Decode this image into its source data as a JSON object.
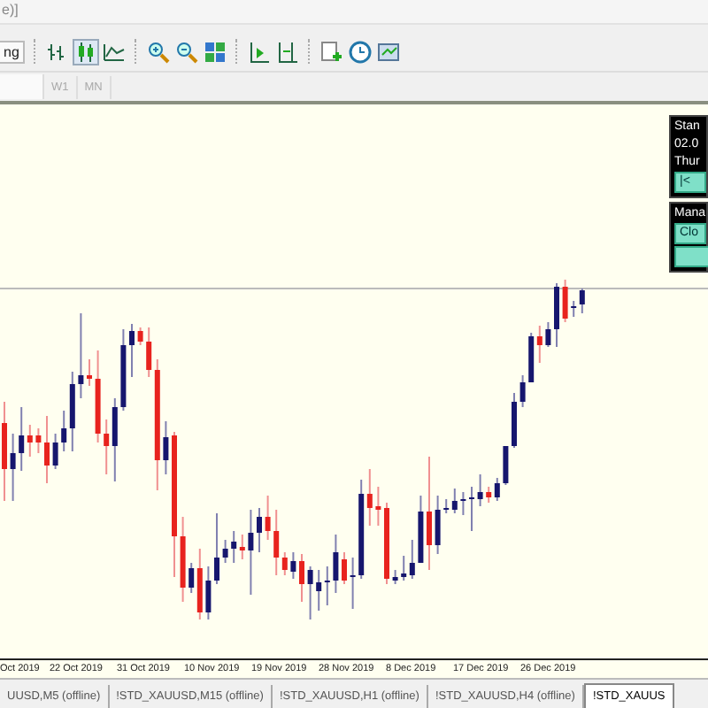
{
  "window": {
    "title": "e)]"
  },
  "toolbar": {
    "partial_button": "ng"
  },
  "timeframes": [
    {
      "label": "W1"
    },
    {
      "label": "MN"
    }
  ],
  "chart": {
    "x_labels": [
      "Oct 2019",
      "22 Oct 2019",
      "31 Oct 2019",
      "10 Nov 2019",
      "19 Nov 2019",
      "28 Nov 2019",
      "8 Dec 2019",
      "17 Dec 2019",
      "26 Dec 2019"
    ]
  },
  "trade_panel": {
    "info_lines": [
      "Stan",
      "02.0",
      "Thur"
    ],
    "nav_button": "|<",
    "manage_label": "Mana",
    "close_button": "Clo"
  },
  "tabs": [
    {
      "label": "UUSD,M5 (offline)",
      "selected": false
    },
    {
      "label": "!STD_XAUUSD,M15 (offline)",
      "selected": false
    },
    {
      "label": "!STD_XAUUSD,H1 (offline)",
      "selected": false
    },
    {
      "label": "!STD_XAUUSD,H4 (offline)",
      "selected": false
    },
    {
      "label": "!STD_XAUUS",
      "selected": true
    }
  ]
}
